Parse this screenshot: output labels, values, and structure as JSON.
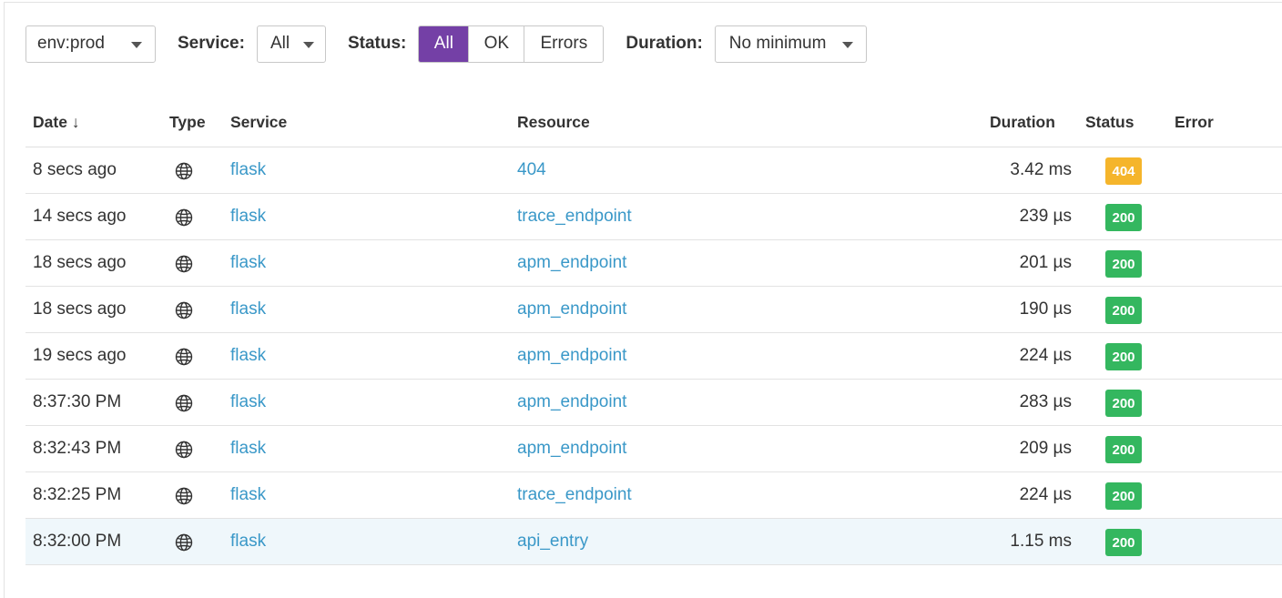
{
  "filters": {
    "env": {
      "value": "env:prod"
    },
    "service": {
      "label": "Service:",
      "value": "All"
    },
    "status": {
      "label": "Status:",
      "options": [
        "All",
        "OK",
        "Errors"
      ],
      "selected": "All"
    },
    "duration": {
      "label": "Duration:",
      "value": "No minimum"
    }
  },
  "table": {
    "headers": {
      "date": "Date ↓",
      "type": "Type",
      "service": "Service",
      "resource": "Resource",
      "duration": "Duration",
      "status": "Status",
      "error": "Error"
    },
    "type_icon": "globe-icon",
    "rows": [
      {
        "date": "8 secs ago",
        "service": "flask",
        "resource": "404",
        "duration": "3.42 ms",
        "status": "404",
        "status_kind": "warn"
      },
      {
        "date": "14 secs ago",
        "service": "flask",
        "resource": "trace_endpoint",
        "duration": "239 µs",
        "status": "200",
        "status_kind": "ok"
      },
      {
        "date": "18 secs ago",
        "service": "flask",
        "resource": "apm_endpoint",
        "duration": "201 µs",
        "status": "200",
        "status_kind": "ok"
      },
      {
        "date": "18 secs ago",
        "service": "flask",
        "resource": "apm_endpoint",
        "duration": "190 µs",
        "status": "200",
        "status_kind": "ok"
      },
      {
        "date": "19 secs ago",
        "service": "flask",
        "resource": "apm_endpoint",
        "duration": "224 µs",
        "status": "200",
        "status_kind": "ok"
      },
      {
        "date": "8:37:30 PM",
        "service": "flask",
        "resource": "apm_endpoint",
        "duration": "283 µs",
        "status": "200",
        "status_kind": "ok"
      },
      {
        "date": "8:32:43 PM",
        "service": "flask",
        "resource": "apm_endpoint",
        "duration": "209 µs",
        "status": "200",
        "status_kind": "ok"
      },
      {
        "date": "8:32:25 PM",
        "service": "flask",
        "resource": "trace_endpoint",
        "duration": "224 µs",
        "status": "200",
        "status_kind": "ok"
      },
      {
        "date": "8:32:00 PM",
        "service": "flask",
        "resource": "api_entry",
        "duration": "1.15 ms",
        "status": "200",
        "status_kind": "ok",
        "highlighted": true
      }
    ]
  },
  "colors": {
    "accent": "#7440a6",
    "link": "#3a98c8",
    "status_ok": "#34b75f",
    "status_warn": "#f5b52b",
    "row_highlight": "#eff7fb"
  }
}
